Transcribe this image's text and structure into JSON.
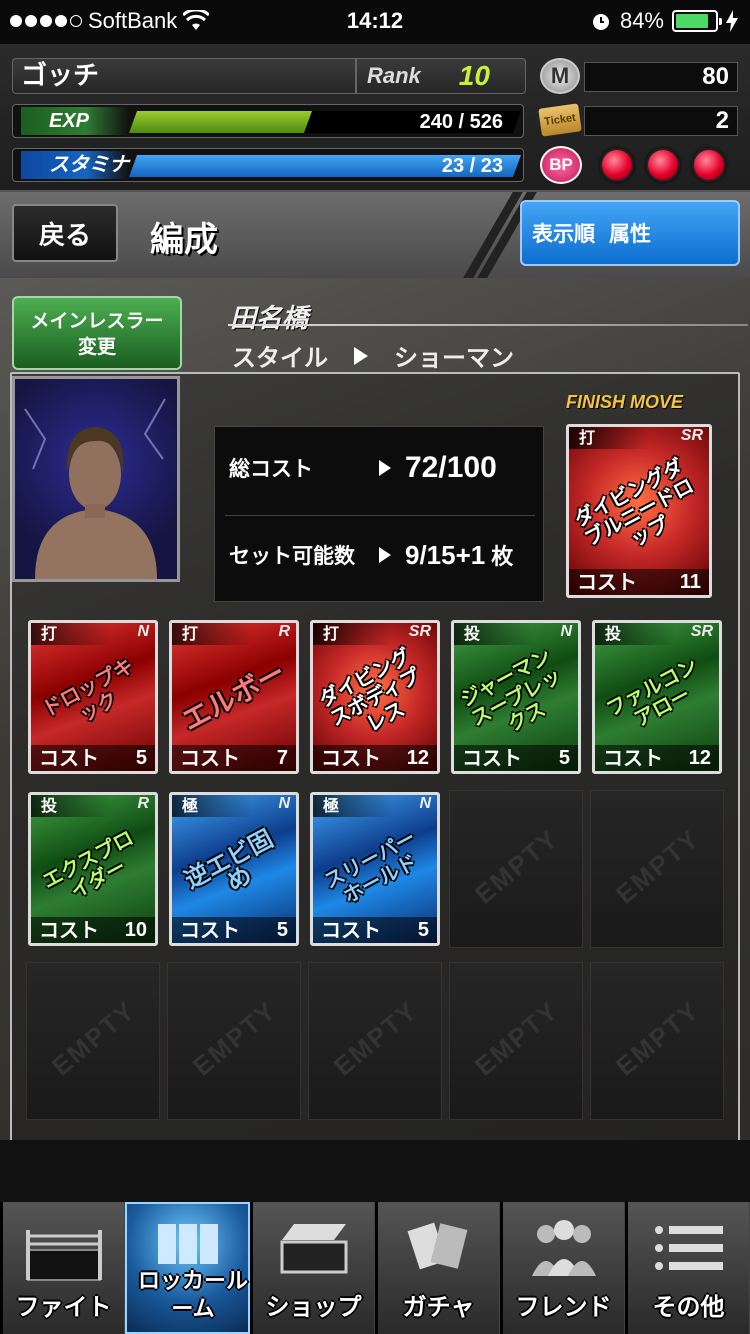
{
  "status_bar": {
    "carrier": "SoftBank",
    "time": "14:12",
    "battery": "84%",
    "battery_level": 0.84,
    "signal_dots": 4
  },
  "player": {
    "name": "ゴッチ",
    "rank_label": "Rank",
    "rank": "10",
    "exp_label": "EXP",
    "exp_value": "240 / 526",
    "exp_fraction": 0.456,
    "stamina_label": "スタミナ",
    "stamina_value": "23 / 23",
    "stamina_fraction": 1.0
  },
  "resources": {
    "m_icon": "M",
    "m_value": "80",
    "ticket_icon": "Ticket",
    "ticket_value": "2",
    "bp_label": "BP",
    "bp_orbs": 3
  },
  "titlebar": {
    "back": "戻る",
    "title": "編成",
    "sort_label": "表示順",
    "sort_value": "属性"
  },
  "main": {
    "change_button": "メインレスラー変更",
    "wrestler_name": "田名橋",
    "style_label": "スタイル",
    "style_value": "ショーマン",
    "total_cost_label": "総コスト",
    "total_cost_value": "72/100",
    "set_count_label": "セット可能数",
    "set_count_value": "9/15+1",
    "set_count_unit": "枚",
    "finish_move_label": "FINISH MOVE",
    "empty_label": "EMPTY"
  },
  "finish_card": {
    "type": "打",
    "rarity": "SR",
    "name": "ダイビングダブルニードロップ",
    "cost_label": "コスト",
    "cost": "11",
    "color": "fire"
  },
  "cards": [
    {
      "type": "打",
      "rarity": "N",
      "name": "ドロップキック",
      "cost_label": "コスト",
      "cost": "5",
      "color": "red"
    },
    {
      "type": "打",
      "rarity": "R",
      "name": "エルボー",
      "cost_label": "コスト",
      "cost": "7",
      "color": "red"
    },
    {
      "type": "打",
      "rarity": "SR",
      "name": "ダイビングスボディプレス",
      "cost_label": "コスト",
      "cost": "12",
      "color": "fire"
    },
    {
      "type": "投",
      "rarity": "N",
      "name": "ジャーマンスープレックス",
      "cost_label": "コスト",
      "cost": "5",
      "color": "green"
    },
    {
      "type": "投",
      "rarity": "SR",
      "name": "ファルコンアロー",
      "cost_label": "コスト",
      "cost": "12",
      "color": "green"
    },
    {
      "type": "投",
      "rarity": "R",
      "name": "エクスプロイダー",
      "cost_label": "コスト",
      "cost": "10",
      "color": "green"
    },
    {
      "type": "極",
      "rarity": "N",
      "name": "逆エビ固め",
      "cost_label": "コスト",
      "cost": "5",
      "color": "blue"
    },
    {
      "type": "極",
      "rarity": "N",
      "name": "スリーパーホールド",
      "cost_label": "コスト",
      "cost": "5",
      "color": "blue"
    }
  ],
  "tabs": [
    {
      "label": "ファイト",
      "icon": "ring-icon"
    },
    {
      "label": "ロッカールーム",
      "icon": "locker-icon",
      "active": true
    },
    {
      "label": "ショップ",
      "icon": "shop-icon"
    },
    {
      "label": "ガチャ",
      "icon": "cards-icon"
    },
    {
      "label": "フレンド",
      "icon": "friends-icon"
    },
    {
      "label": "その他",
      "icon": "menu-icon"
    }
  ],
  "colors": {
    "exp_bar": "#7cc12a",
    "stamina_bar": "#1e88e5",
    "sort_button": "#1976d2",
    "change_button": "#2e7d32",
    "rank_value": "#c8f03c",
    "finish_move": "#f5c542"
  }
}
